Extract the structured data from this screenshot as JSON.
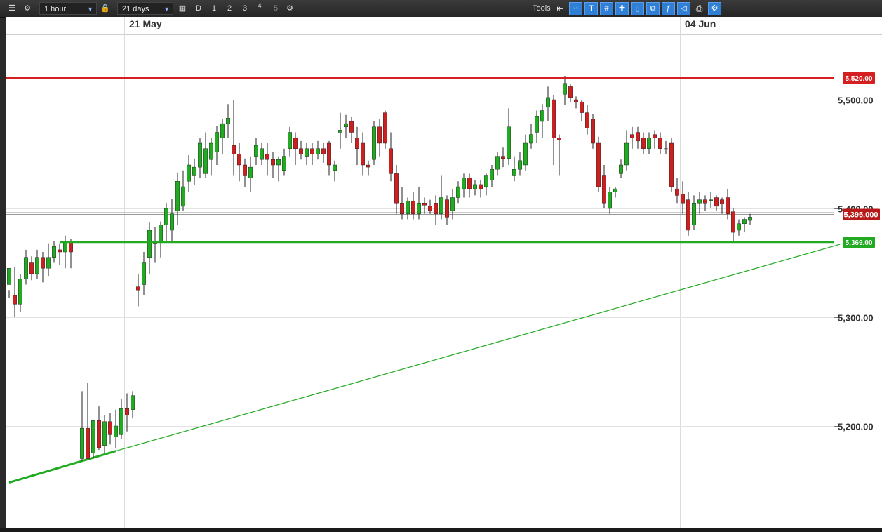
{
  "toolbar": {
    "interval": "1 hour",
    "range": "21 days",
    "period_buttons": [
      "D",
      "1",
      "2",
      "3",
      "4",
      "5"
    ],
    "tools_label": "Tools"
  },
  "chart_data": {
    "type": "candlestick",
    "instrument_price_axis": {
      "ticks": [
        5200,
        5300,
        5400,
        5500
      ],
      "tick_labels": [
        "5,200.00",
        "5,300.00",
        "5,400.00",
        "5,500.00"
      ],
      "ylim": [
        5148,
        5562
      ]
    },
    "x_labels": [
      "21 May",
      "04 Jun"
    ],
    "horizontal_lines": [
      {
        "label": "5,520.00",
        "value": 5520,
        "color": "#d42020"
      },
      {
        "label": "5,369.00",
        "value": 5369,
        "color": "#22aa22"
      }
    ],
    "current_price": {
      "label": "5,395.000",
      "value": 5395,
      "color": "#b81818"
    },
    "trendlines": [
      {
        "from": [
          0,
          5148
        ],
        "to": [
          19,
          5177
        ],
        "color": "#22aa22",
        "width": 3
      },
      {
        "from": [
          19,
          5177
        ],
        "to": [
          148,
          5367
        ],
        "color": "#22aa22",
        "width": 1.2
      }
    ],
    "candles": [
      [
        5330,
        5345,
        5318,
        5325
      ],
      [
        5320,
        5312,
        5300,
        5346
      ],
      [
        5312,
        5335,
        5305,
        5340
      ],
      [
        5335,
        5355,
        5330,
        5362
      ],
      [
        5350,
        5340,
        5334,
        5356
      ],
      [
        5340,
        5355,
        5335,
        5362
      ],
      [
        5355,
        5345,
        5332,
        5360
      ],
      [
        5345,
        5355,
        5338,
        5368
      ],
      [
        5355,
        5365,
        5350,
        5370
      ],
      [
        5362,
        5360,
        5348,
        5368
      ],
      [
        5360,
        5370,
        5345,
        5375
      ],
      [
        5370,
        5360,
        5345,
        5372
      ],
      [
        5170,
        5198,
        5168,
        5232
      ],
      [
        5198,
        5170,
        5182,
        5240
      ],
      [
        5175,
        5205,
        5170,
        5202
      ],
      [
        5205,
        5180,
        5178,
        5218
      ],
      [
        5182,
        5204,
        5175,
        5210
      ],
      [
        5204,
        5192,
        5183,
        5212
      ],
      [
        5190,
        5200,
        5180,
        5215
      ],
      [
        5192,
        5216,
        5188,
        5225
      ],
      [
        5216,
        5210,
        5195,
        5230
      ],
      [
        5215,
        5228,
        5207,
        5232
      ],
      [
        5328,
        5325,
        5310,
        5340
      ],
      [
        5330,
        5350,
        5320,
        5360
      ],
      [
        5355,
        5380,
        5340,
        5387
      ],
      [
        5368,
        5370,
        5350,
        5383
      ],
      [
        5370,
        5385,
        5355,
        5388
      ],
      [
        5385,
        5400,
        5370,
        5405
      ],
      [
        5380,
        5395,
        5370,
        5409
      ],
      [
        5398,
        5425,
        5385,
        5433
      ],
      [
        5402,
        5420,
        5398,
        5435
      ],
      [
        5425,
        5440,
        5415,
        5449
      ],
      [
        5430,
        5438,
        5422,
        5446
      ],
      [
        5438,
        5460,
        5428,
        5465
      ],
      [
        5432,
        5455,
        5428,
        5470
      ],
      [
        5445,
        5460,
        5430,
        5465
      ],
      [
        5452,
        5470,
        5440,
        5476
      ],
      [
        5465,
        5478,
        5450,
        5482
      ],
      [
        5478,
        5483,
        5465,
        5496
      ],
      [
        5458,
        5450,
        5430,
        5500
      ],
      [
        5450,
        5440,
        5425,
        5460
      ],
      [
        5440,
        5430,
        5420,
        5446
      ],
      [
        5428,
        5438,
        5415,
        5448
      ],
      [
        5448,
        5458,
        5440,
        5465
      ],
      [
        5445,
        5455,
        5440,
        5460
      ],
      [
        5450,
        5445,
        5430,
        5460
      ],
      [
        5445,
        5440,
        5428,
        5452
      ],
      [
        5440,
        5445,
        5425,
        5448
      ],
      [
        5435,
        5448,
        5430,
        5455
      ],
      [
        5455,
        5470,
        5448,
        5475
      ],
      [
        5465,
        5455,
        5440,
        5470
      ],
      [
        5455,
        5450,
        5445,
        5462
      ],
      [
        5448,
        5455,
        5440,
        5460
      ],
      [
        5455,
        5450,
        5440,
        5460
      ],
      [
        5450,
        5455,
        5445,
        5462
      ],
      [
        5455,
        5450,
        5442,
        5460
      ],
      [
        5460,
        5440,
        5430,
        5462
      ],
      [
        5435,
        5440,
        5425,
        5444
      ],
      [
        5470,
        5472,
        5455,
        5488
      ],
      [
        5475,
        5478,
        5465,
        5486
      ],
      [
        5480,
        5470,
        5460,
        5484
      ],
      [
        5465,
        5455,
        5440,
        5475
      ],
      [
        5460,
        5440,
        5430,
        5470
      ],
      [
        5440,
        5438,
        5430,
        5444
      ],
      [
        5445,
        5475,
        5440,
        5480
      ],
      [
        5475,
        5460,
        5448,
        5482
      ],
      [
        5488,
        5460,
        5455,
        5490
      ],
      [
        5455,
        5432,
        5425,
        5470
      ],
      [
        5432,
        5405,
        5395,
        5440
      ],
      [
        5405,
        5395,
        5390,
        5420
      ],
      [
        5395,
        5407,
        5390,
        5410
      ],
      [
        5407,
        5395,
        5390,
        5415
      ],
      [
        5395,
        5405,
        5390,
        5420
      ],
      [
        5405,
        5403,
        5395,
        5410
      ],
      [
        5402,
        5398,
        5395,
        5408
      ],
      [
        5405,
        5395,
        5385,
        5412
      ],
      [
        5395,
        5410,
        5390,
        5430
      ],
      [
        5408,
        5392,
        5385,
        5412
      ],
      [
        5398,
        5410,
        5390,
        5418
      ],
      [
        5410,
        5420,
        5405,
        5425
      ],
      [
        5418,
        5428,
        5410,
        5432
      ],
      [
        5428,
        5418,
        5410,
        5432
      ],
      [
        5418,
        5422,
        5412,
        5426
      ],
      [
        5422,
        5418,
        5410,
        5426
      ],
      [
        5420,
        5430,
        5412,
        5432
      ],
      [
        5426,
        5436,
        5420,
        5440
      ],
      [
        5436,
        5448,
        5430,
        5452
      ],
      [
        5448,
        5446,
        5438,
        5456
      ],
      [
        5446,
        5475,
        5440,
        5492
      ],
      [
        5430,
        5436,
        5425,
        5448
      ],
      [
        5436,
        5444,
        5430,
        5452
      ],
      [
        5440,
        5460,
        5435,
        5468
      ],
      [
        5460,
        5468,
        5455,
        5478
      ],
      [
        5470,
        5485,
        5460,
        5490
      ],
      [
        5480,
        5490,
        5465,
        5496
      ],
      [
        5493,
        5502,
        5480,
        5512
      ],
      [
        5500,
        5465,
        5440,
        5504
      ],
      [
        5465,
        5463,
        5430,
        5468
      ],
      [
        5505,
        5515,
        5495,
        5522
      ],
      [
        5512,
        5502,
        5498,
        5514
      ],
      [
        5500,
        5498,
        5492,
        5503
      ],
      [
        5498,
        5488,
        5480,
        5500
      ],
      [
        5488,
        5474,
        5468,
        5495
      ],
      [
        5482,
        5460,
        5455,
        5487
      ],
      [
        5460,
        5420,
        5415,
        5466
      ],
      [
        5430,
        5405,
        5400,
        5440
      ],
      [
        5400,
        5415,
        5395,
        5420
      ],
      [
        5415,
        5418,
        5410,
        5420
      ],
      [
        5432,
        5440,
        5428,
        5445
      ],
      [
        5440,
        5460,
        5435,
        5472
      ],
      [
        5468,
        5465,
        5455,
        5475
      ],
      [
        5470,
        5462,
        5455,
        5475
      ],
      [
        5465,
        5455,
        5450,
        5470
      ],
      [
        5455,
        5465,
        5450,
        5470
      ],
      [
        5468,
        5465,
        5455,
        5472
      ],
      [
        5465,
        5455,
        5450,
        5470
      ],
      [
        5455,
        5455,
        5450,
        5462
      ],
      [
        5460,
        5420,
        5415,
        5465
      ],
      [
        5418,
        5412,
        5405,
        5428
      ],
      [
        5413,
        5405,
        5395,
        5425
      ],
      [
        5408,
        5380,
        5375,
        5415
      ],
      [
        5385,
        5405,
        5380,
        5412
      ],
      [
        5405,
        5408,
        5395,
        5415
      ],
      [
        5408,
        5405,
        5398,
        5412
      ],
      [
        5408,
        5408,
        5400,
        5415
      ],
      [
        5410,
        5402,
        5398,
        5412
      ],
      [
        5408,
        5404,
        5395,
        5410
      ],
      [
        5410,
        5395,
        5390,
        5418
      ],
      [
        5397,
        5378,
        5370,
        5400
      ],
      [
        5380,
        5386,
        5375,
        5390
      ],
      [
        5386,
        5390,
        5378,
        5392
      ],
      [
        5389,
        5392,
        5385,
        5395
      ]
    ],
    "candle_colors": {
      "up": "#22aa22",
      "down": "#cc2020"
    }
  }
}
